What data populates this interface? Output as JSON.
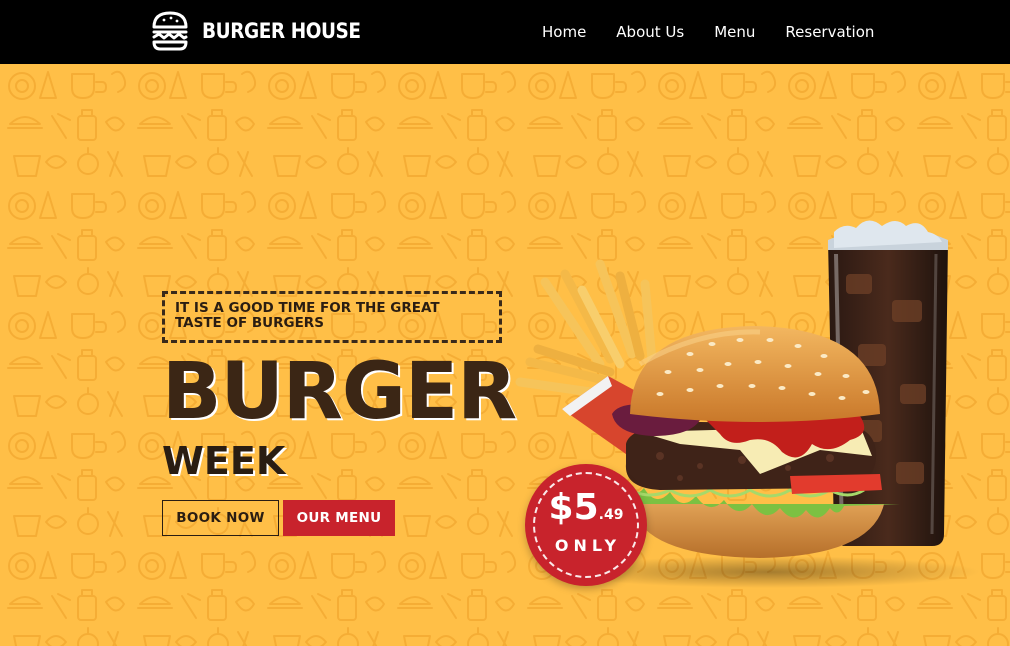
{
  "brand": {
    "name": "BURGER HOUSE",
    "logo_icon": "burger-icon"
  },
  "nav": {
    "items": [
      "Home",
      "About Us",
      "Menu",
      "Reservation"
    ]
  },
  "hero": {
    "tagline": "IT IS A GOOD TIME FOR THE GREAT TASTE OF BURGERS",
    "title_main": "BURGER",
    "title_sub": "WEEK",
    "book_button": "BOOK NOW",
    "menu_button": "OUR MENU"
  },
  "price_badge": {
    "dollars": "$5",
    "cents": ".49",
    "label": "ONLY"
  },
  "colors": {
    "header_bg": "#000000",
    "hero_bg": "#ffbf47",
    "accent_red": "#c8232c",
    "text_brown": "#3b2615"
  }
}
